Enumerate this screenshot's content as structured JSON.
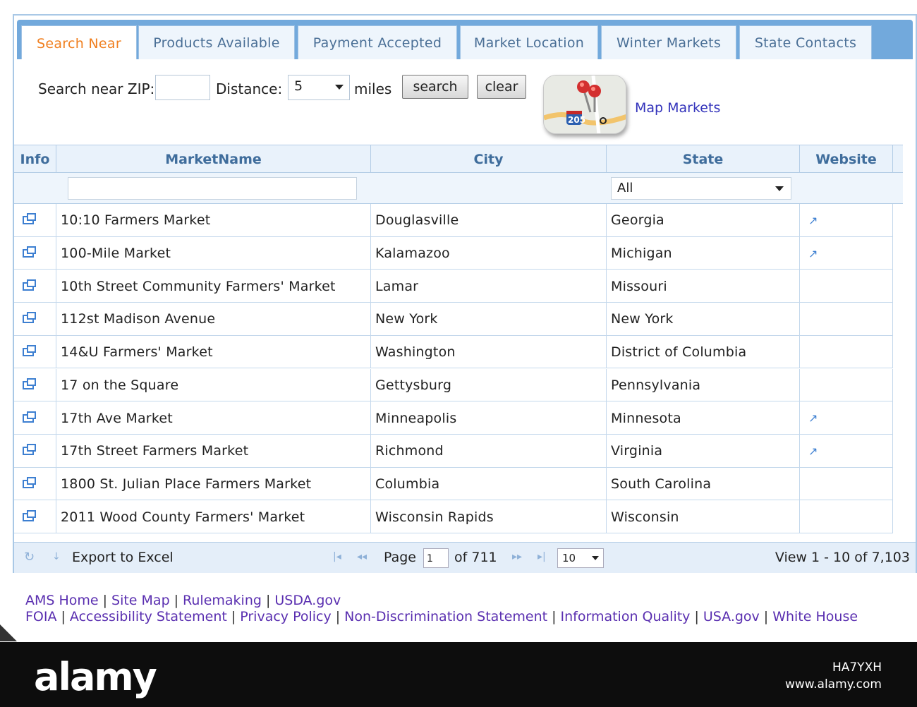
{
  "tabs": [
    {
      "label": "Search Near",
      "active": true
    },
    {
      "label": "Products Available",
      "active": false
    },
    {
      "label": "Payment Accepted",
      "active": false
    },
    {
      "label": "Market Location",
      "active": false
    },
    {
      "label": "Winter Markets",
      "active": false
    },
    {
      "label": "State Contacts",
      "active": false
    }
  ],
  "search": {
    "zip_label": "Search near ZIP:",
    "zip_value": "",
    "distance_label": "Distance:",
    "distance_value": "5",
    "miles_label": "miles",
    "search_button": "search",
    "clear_button": "clear",
    "map_link": "Map Markets",
    "map_tile_label": "205"
  },
  "grid": {
    "columns": [
      "Info",
      "MarketName",
      "City",
      "State",
      "Website"
    ],
    "state_filter": "All",
    "rows": [
      {
        "name": "10:10 Farmers Market",
        "city": "Douglasville",
        "state": "Georgia",
        "website": true
      },
      {
        "name": "100-Mile Market",
        "city": "Kalamazoo",
        "state": "Michigan",
        "website": true
      },
      {
        "name": "10th Street Community Farmers' Market",
        "city": "Lamar",
        "state": "Missouri",
        "website": false
      },
      {
        "name": "112st Madison Avenue",
        "city": "New York",
        "state": "New York",
        "website": false
      },
      {
        "name": "14&U Farmers' Market",
        "city": "Washington",
        "state": "District of Columbia",
        "website": false
      },
      {
        "name": "17 on the Square",
        "city": "Gettysburg",
        "state": "Pennsylvania",
        "website": false
      },
      {
        "name": "17th Ave Market",
        "city": "Minneapolis",
        "state": "Minnesota",
        "website": true
      },
      {
        "name": "17th Street Farmers Market",
        "city": "Richmond",
        "state": "Virginia",
        "website": true
      },
      {
        "name": "1800 St. Julian Place Farmers Market",
        "city": "Columbia",
        "state": "South Carolina",
        "website": false
      },
      {
        "name": "2011 Wood County Farmers' Market",
        "city": "Wisconsin Rapids",
        "state": "Wisconsin",
        "website": false
      }
    ]
  },
  "pager": {
    "export_label": "Export to Excel",
    "page_label": "Page",
    "page_value": "1",
    "of_label": "of 711",
    "rows_per_page": "10",
    "view_label": "View 1 - 10 of 7,103"
  },
  "footer": {
    "line1": [
      "AMS Home",
      "Site Map",
      "Rulemaking",
      "USDA.gov"
    ],
    "line2": [
      "FOIA",
      "Accessibility Statement",
      "Privacy Policy",
      "Non-Discrimination Statement",
      "Information Quality",
      "USA.gov",
      "White House"
    ]
  },
  "watermark": {
    "logo": "alamy",
    "image_id": "HA7YXH",
    "url": "www.alamy.com"
  }
}
